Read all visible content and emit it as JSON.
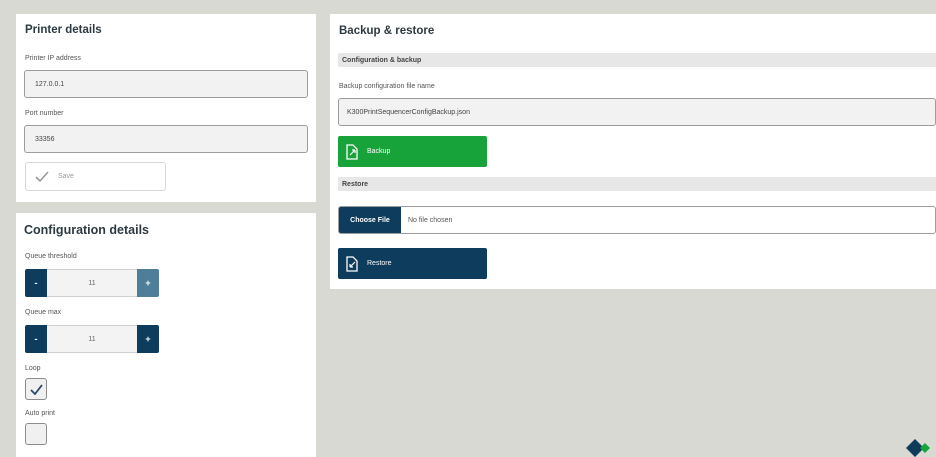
{
  "printer": {
    "title": "Printer details",
    "ip_label": "Printer IP address",
    "ip_value": "127.0.0.1",
    "port_label": "Port number",
    "port_value": "33356",
    "save_label": "Save"
  },
  "config": {
    "title": "Configuration details",
    "queue_threshold_label": "Queue threshold",
    "queue_threshold_value": "11",
    "queue_max_label": "Queue max",
    "queue_max_value": "11",
    "minus": "-",
    "plus": "+",
    "loop_label": "Loop",
    "loop_checked": true,
    "auto_print_label": "Auto print",
    "auto_print_checked": false
  },
  "backup": {
    "title": "Backup & restore",
    "config_section": "Configuration & backup",
    "file_name_label": "Backup configuration file name",
    "file_name_value": "K300PrintSequencerConfigBackup.json",
    "backup_label": "Backup",
    "restore_section": "Restore",
    "choose_file_label": "Choose File",
    "no_file_label": "No file chosen",
    "restore_label": "Restore"
  },
  "colors": {
    "navy": "#0d3c5c",
    "green": "#17a33a",
    "background": "#d9d9d4"
  },
  "icons": [
    "check-icon",
    "file-export-icon",
    "file-import-icon",
    "brand-logo-icon"
  ]
}
